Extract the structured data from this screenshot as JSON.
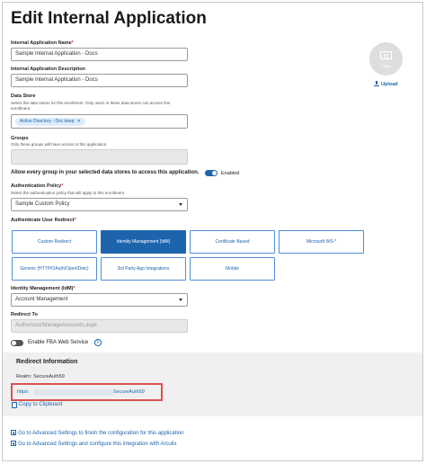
{
  "page": {
    "title": "Edit Internal Application"
  },
  "form": {
    "name": {
      "label": "Internal Application Name",
      "value": "Sample Internal Application - Docs"
    },
    "description": {
      "label": "Internal Application Description",
      "value": "Sample Internal Application - Docs"
    },
    "data_store": {
      "label": "Data Store",
      "help": "Select the data stores for this enrollment. Only users in these data stores can access this enrollment.",
      "chips": [
        {
          "label": "Active Directory - Doc keep",
          "remove": "✕"
        }
      ]
    },
    "groups": {
      "label": "Groups",
      "help": "Only these groups will have access to this application."
    },
    "allow_all": {
      "label": "Allow every group in your selected data stores to access this application.",
      "state": "Enabled"
    },
    "auth_policy": {
      "label": "Authentication Policy",
      "help": "Select the authentication policy that will apply to this enrollment",
      "value": "Sample Custom Policy"
    },
    "redirect_type": {
      "label": "Authenticate User Redirect",
      "options": [
        {
          "label": "Custom Redirect",
          "selected": false
        },
        {
          "label": "Identity Management (IdM)",
          "selected": true
        },
        {
          "label": "Certificate Based",
          "selected": false
        },
        {
          "label": "Microsoft WS-*",
          "selected": false
        },
        {
          "label": "Generic (HTTP/OAuth/OpenIDetc)",
          "selected": false
        },
        {
          "label": "3rd Party App Integrations",
          "selected": false
        },
        {
          "label": "Mobile",
          "selected": false
        }
      ]
    },
    "idm": {
      "label": "Identity Management (IdM)",
      "value": "Account Management"
    },
    "redirect_to": {
      "label": "Redirect To",
      "value": "Authorized/ManageAccounts.aspx"
    },
    "fba": {
      "label": "Enable FBA Web Service",
      "info": "i"
    }
  },
  "logo": {
    "text": "Logo",
    "upload_label": "Upload"
  },
  "redirect_info": {
    "title": "Redirect Information",
    "realm": "Realm: SecureAuth59",
    "url_start": "https:",
    "url_end": "SecureAuth59",
    "copy_label": "Copy to Clipboard"
  },
  "advanced": {
    "link1": "Go to Advanced Settings to finish the configuration for this application",
    "link2": "Go to Advanced Settings and configure this integration with Arculix"
  },
  "colors": {
    "accent": "#1d64ad",
    "highlight": "#d9534f"
  }
}
